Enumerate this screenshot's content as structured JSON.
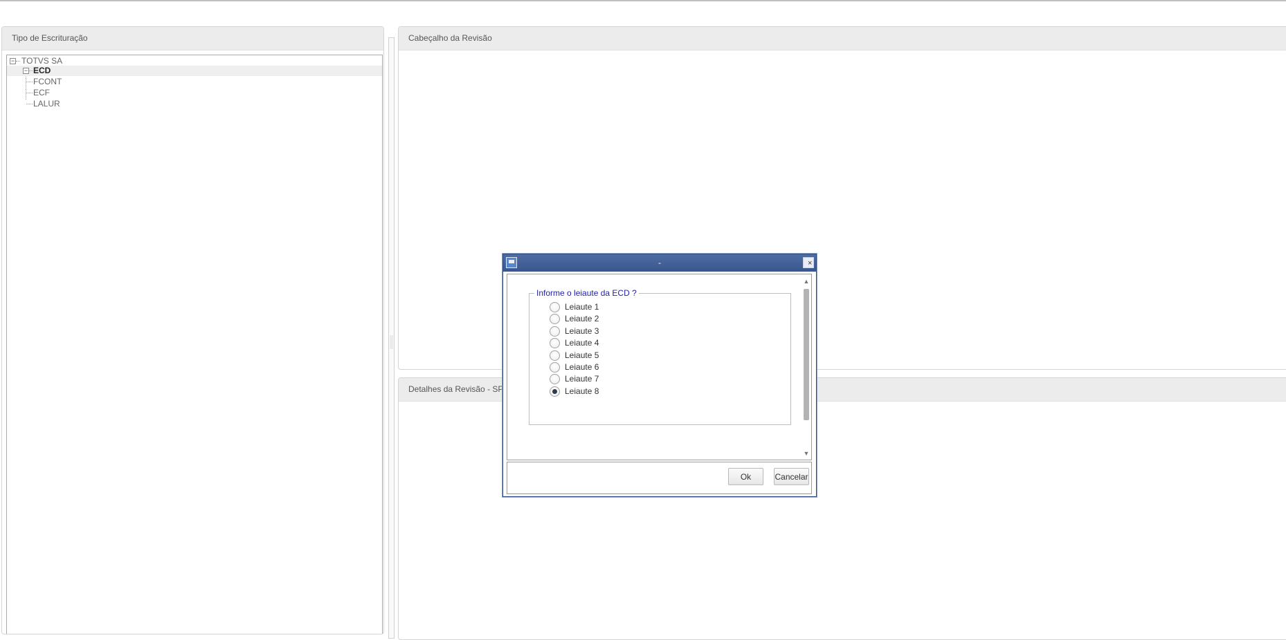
{
  "left_panel": {
    "title": "Tipo de Escrituração",
    "tree": {
      "root": "TOTVS SA",
      "children": [
        {
          "label": "ECD",
          "selected": true
        },
        {
          "label": "FCONT"
        },
        {
          "label": "ECF"
        },
        {
          "label": "LALUR"
        }
      ]
    }
  },
  "right_top_panel": {
    "title": "Cabeçalho da Revisão"
  },
  "right_bottom_panel": {
    "title": "Detalhes da Revisão - SPED"
  },
  "dialog": {
    "title": "-",
    "close_label": "×",
    "group_label": "Informe o leiaute da ECD  ?",
    "options": [
      {
        "label": "Leiaute 1",
        "checked": false
      },
      {
        "label": "Leiaute 2",
        "checked": false
      },
      {
        "label": "Leiaute 3",
        "checked": false
      },
      {
        "label": "Leiaute 4",
        "checked": false
      },
      {
        "label": "Leiaute 5",
        "checked": false
      },
      {
        "label": "Leiaute 6",
        "checked": false
      },
      {
        "label": "Leiaute 7",
        "checked": false
      },
      {
        "label": "Leiaute 8",
        "checked": true
      }
    ],
    "ok_label": "Ok",
    "cancel_label": "Cancelar"
  },
  "icons": {
    "tree_expand": "tree-collapse-icon",
    "dialog_app": "app-window-icon",
    "dialog_close": "close-icon",
    "scroll_up": "arrow-up-icon",
    "scroll_down": "arrow-down-icon"
  },
  "colors": {
    "dialog_titlebar": "#3a568d",
    "group_label": "#2222aa"
  }
}
